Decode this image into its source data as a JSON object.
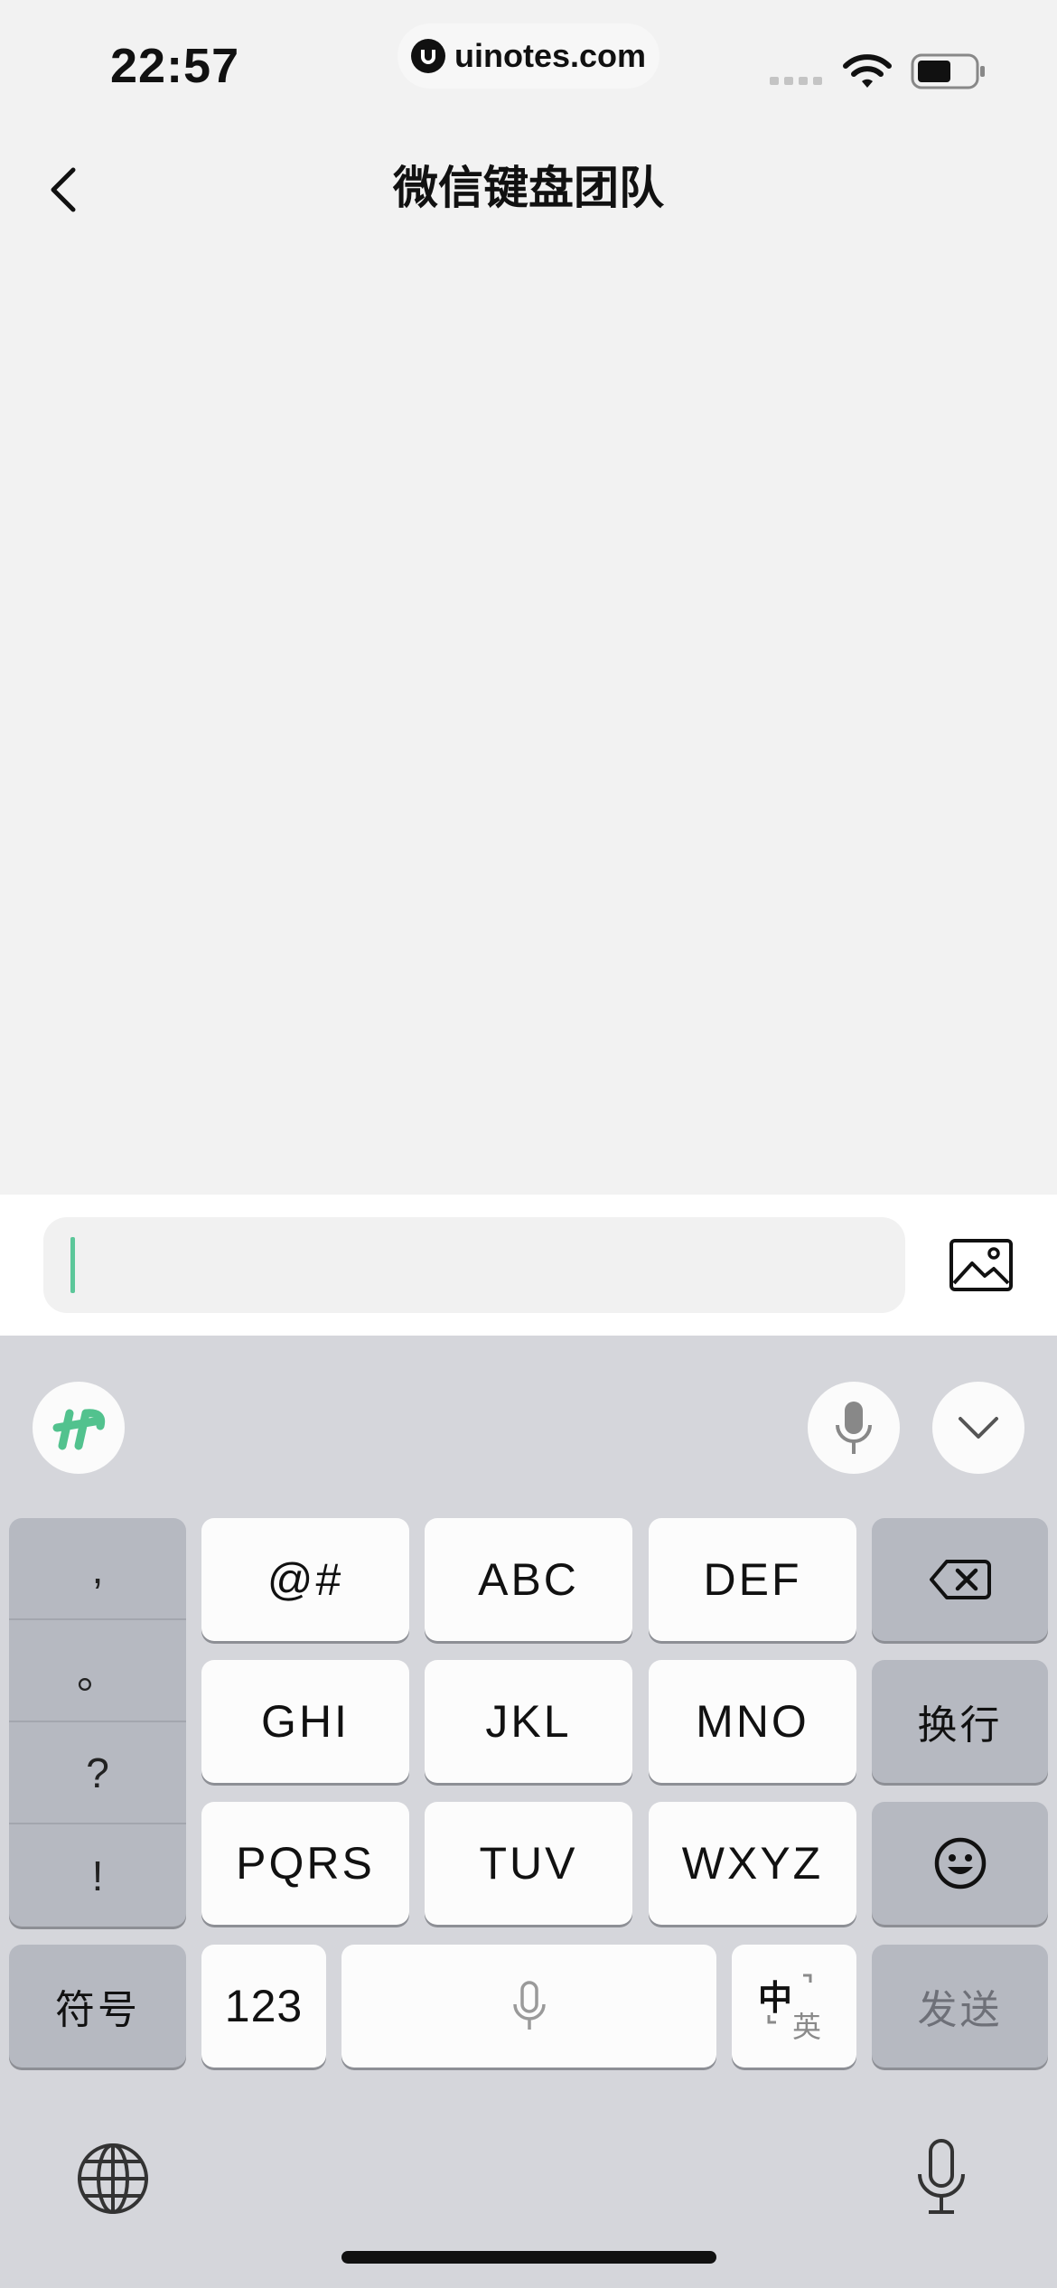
{
  "status_bar": {
    "time": "22:57",
    "url": "uinotes.com"
  },
  "header": {
    "title": "微信键盘团队"
  },
  "input": {
    "value": ""
  },
  "keyboard": {
    "punctuation": [
      ",",
      "。",
      "?",
      "!"
    ],
    "rows": [
      [
        "@#",
        "ABC",
        "DEF"
      ],
      [
        "GHI",
        "JKL",
        "MNO"
      ],
      [
        "PQRS",
        "TUV",
        "WXYZ"
      ]
    ],
    "newline_label": "换行",
    "symbols_label": "符号",
    "numbers_label": "123",
    "lang_zh": "中",
    "lang_en": "英",
    "send_label": "发送"
  },
  "colors": {
    "accent": "#5cc79a",
    "keyboard_bg": "#d5d6db",
    "key_dark": "#b6b9c1"
  }
}
